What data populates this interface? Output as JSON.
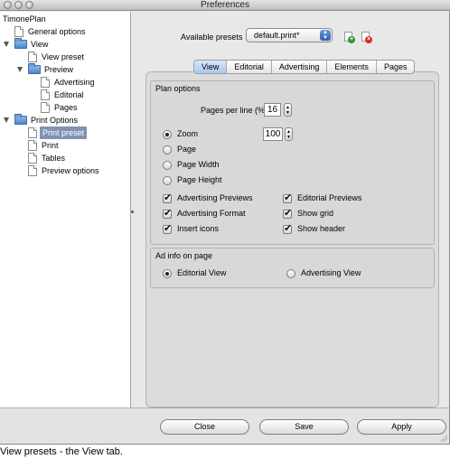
{
  "window": {
    "title": "Preferences"
  },
  "sidebar": {
    "items": [
      {
        "label": "TimonePlan",
        "icon": "no-icon"
      },
      {
        "label": "General options",
        "icon": "document-icon"
      },
      {
        "label": "View",
        "icon": "folder-icon"
      },
      {
        "label": "View preset",
        "icon": "document-icon"
      },
      {
        "label": "Preview",
        "icon": "folder-icon"
      },
      {
        "label": "Advertising",
        "icon": "document-icon"
      },
      {
        "label": "Editorial",
        "icon": "document-icon"
      },
      {
        "label": "Pages",
        "icon": "document-icon"
      },
      {
        "label": "Print Options",
        "icon": "folder-icon"
      },
      {
        "label": "Print preset",
        "icon": "document-icon",
        "selected": true
      },
      {
        "label": "Print",
        "icon": "document-icon"
      },
      {
        "label": "Tables",
        "icon": "document-icon"
      },
      {
        "label": "Preview options",
        "icon": "document-icon"
      }
    ]
  },
  "presets": {
    "label": "Available presets",
    "selected": "default.print*"
  },
  "tabs": [
    {
      "label": "View",
      "active": true
    },
    {
      "label": "Editorial"
    },
    {
      "label": "Advertising"
    },
    {
      "label": "Elements"
    },
    {
      "label": "Pages"
    }
  ],
  "plan_options": {
    "title": "Plan options",
    "pages_per_line_label": "Pages per line (%)",
    "pages_per_line_value": "16",
    "zoom_value": "100",
    "radios": [
      {
        "label": "Zoom",
        "checked": true
      },
      {
        "label": "Page",
        "checked": false
      },
      {
        "label": "Page Width",
        "checked": false
      },
      {
        "label": "Page Height",
        "checked": false
      }
    ],
    "checkboxes": [
      {
        "label": "Advertising Previews",
        "checked": true
      },
      {
        "label": "Editorial Previews",
        "checked": true
      },
      {
        "label": "Advertising Format",
        "checked": true
      },
      {
        "label": "Show grid",
        "checked": true
      },
      {
        "label": "Insert icons",
        "checked": true
      },
      {
        "label": "Show header",
        "checked": true
      }
    ]
  },
  "ad_info": {
    "title": "Ad info on page",
    "radios": [
      {
        "label": "Editorial View",
        "checked": true
      },
      {
        "label": "Advertising View",
        "checked": false
      }
    ]
  },
  "buttons": {
    "close": "Close",
    "save": "Save",
    "apply": "Apply"
  },
  "caption": "View presets - the View tab."
}
